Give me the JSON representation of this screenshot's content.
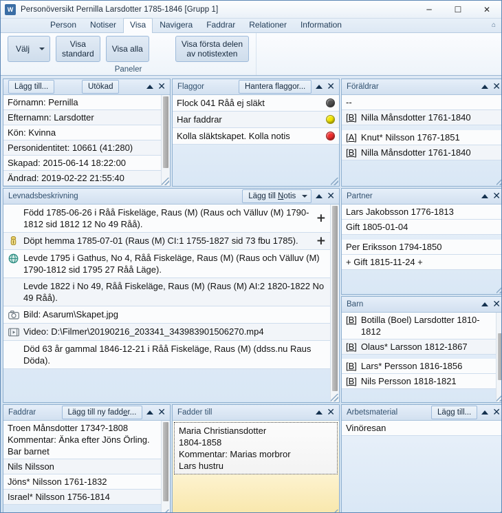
{
  "window": {
    "title": "Personöversikt Pernilla Larsdotter 1785-1846 [Grupp 1]",
    "icon": "W",
    "minimize": "─",
    "maximize": "☐",
    "close": "✕",
    "help_icon": "⌂"
  },
  "ribbon": {
    "tabs": [
      {
        "label": "Person",
        "active": false
      },
      {
        "label": "Notiser",
        "active": false
      },
      {
        "label": "Visa",
        "active": true
      },
      {
        "label": "Navigera",
        "active": false
      },
      {
        "label": "Faddrar",
        "active": false
      },
      {
        "label": "Relationer",
        "active": false
      },
      {
        "label": "Information",
        "active": false
      }
    ],
    "group_label": "Paneler",
    "buttons": {
      "valj": "Välj",
      "visa_standard": "Visa\nstandard",
      "visa_alla": "Visa alla",
      "visa_forsta": "Visa första delen\nav notistexten"
    }
  },
  "panels": {
    "person": {
      "title": "",
      "buttons": {
        "add": "Lägg till...",
        "extended": "Utökad"
      },
      "rows": [
        "Förnamn: Pernilla",
        "Efternamn: Larsdotter",
        "Kön: Kvinna",
        "Personidentitet: 10661 (41:280)",
        "Skapad: 2015-06-14 18:22:00",
        "Ändrad: 2019-02-22 21:55:40"
      ]
    },
    "flaggor": {
      "title": "Flaggor",
      "button": "Hantera flaggor...",
      "rows": [
        {
          "text": "Flock 041 Råå ej släkt",
          "color": "#4f4f4f"
        },
        {
          "text": "Har faddrar",
          "color": "#f2e500"
        },
        {
          "text": "Kolla släktskapet. Kolla notis",
          "color": "#ef2c2c"
        }
      ]
    },
    "foraldrar": {
      "title": "Föräldrar",
      "rows": [
        {
          "tag": "",
          "text": "--"
        },
        {
          "tag": "[B]",
          "text": "Nilla Månsdotter 1761-1840"
        },
        {
          "tag": "[A]",
          "text": "Knut* Nilsson 1767-1851"
        },
        {
          "tag": "[B]",
          "text": "Nilla Månsdotter 1761-1840"
        }
      ]
    },
    "levnad": {
      "title": "Levnadsbeskrivning",
      "button": "Lägg till Notis",
      "button_underline": "N",
      "rows": [
        {
          "icon": "none",
          "text": "Född 1785-06-26 i Råå Fiskeläge, Raus (M) (Raus och Välluv (M) 1790-1812 sid  1812 12 No 49 Råå).",
          "plus": true
        },
        {
          "icon": "baptism-font-icon",
          "text": "Döpt hemma 1785-07-01 (Raus (M) CI:1 1755-1827 sid  73  fbu 1785).",
          "plus": true
        },
        {
          "icon": "globe-icon",
          "text": "Levde 1795 i Gathus, No 4, Råå Fiskeläge, Raus (M) (Raus och Välluv (M) 1790-1812 sid  1795 27 Råå Läge).",
          "plus": false
        },
        {
          "icon": "none",
          "text": "Levde 1822 i No 49, Råå Fiskeläge, Raus (M) (Raus (M) AI:2 1820-1822 No 49 Råå).",
          "plus": false
        },
        {
          "icon": "camera-icon",
          "text": "Bild: Asarum\\Skapet.jpg",
          "plus": false
        },
        {
          "icon": "video-icon",
          "text": "Video: D:\\Filmer\\20190216_203341_343983901506270.mp4",
          "plus": false
        },
        {
          "icon": "none",
          "text": "Död 63 år gammal 1846-12-21 i Råå Fiskeläge, Raus (M) (ddss.nu Raus Döda).",
          "plus": false
        }
      ]
    },
    "partner": {
      "title": "Partner",
      "cards": [
        [
          "Lars Jakobsson 1776-1813",
          "Gift 1805-01-04"
        ],
        [
          "Per Eriksson 1794-1850",
          "+ Gift 1815-11-24 +"
        ]
      ]
    },
    "barn": {
      "title": "Barn",
      "rows": [
        {
          "tag": "[B]",
          "text": "Botilla (Boel) Larsdotter 1810-1812"
        },
        {
          "tag": "[B]",
          "text": "Olaus* Larsson 1812-1867"
        },
        {
          "tag": "[B]",
          "text": "Lars* Persson 1816-1856"
        },
        {
          "tag": "[B]",
          "text": "Nils Persson 1818-1821"
        }
      ]
    },
    "faddrar": {
      "title": "Faddrar",
      "button": "Lägg till ny fadder...",
      "button_underline": "e",
      "rows": [
        "Troen Månsdotter 1734?-1808\nKommentar: Änka efter Jöns Örling. Bar barnet",
        "Nils Nilsson",
        "Jöns* Nilsson 1761-1832",
        "Israel* Nilsson 1756-1814"
      ]
    },
    "fadder_till": {
      "title": "Fadder till",
      "card": "Maria Christiansdotter\n1804-1858\nKommentar: Marias morbror\nLars hustru"
    },
    "arbetsmaterial": {
      "title": "Arbetsmaterial",
      "button": "Lägg till...",
      "button_underline": "g",
      "rows": [
        "Vinöresan"
      ]
    }
  }
}
